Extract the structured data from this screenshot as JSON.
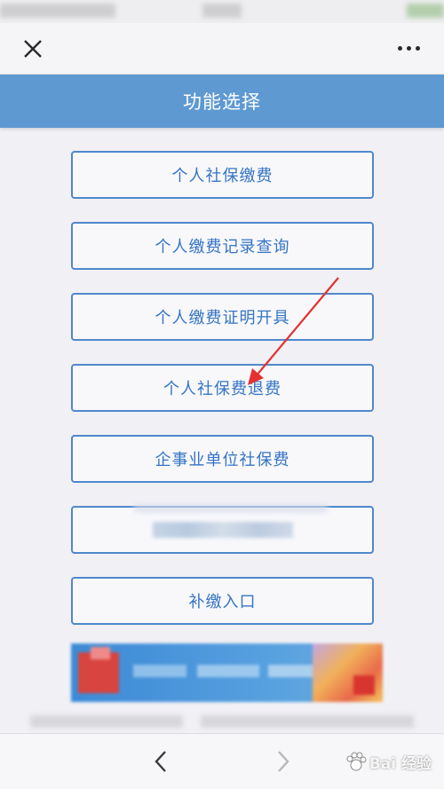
{
  "header": {
    "title": "功能选择"
  },
  "menu": {
    "items": [
      {
        "label": "个人社保缴费",
        "name": "menu-button-personal-payment"
      },
      {
        "label": "个人缴费记录查询",
        "name": "menu-button-payment-record-query"
      },
      {
        "label": "个人缴费证明开具",
        "name": "menu-button-payment-certificate"
      },
      {
        "label": "个人社保费退费",
        "name": "menu-button-personal-refund"
      },
      {
        "label": "企事业单位社保费",
        "name": "menu-button-enterprise-fee"
      },
      {
        "label": "",
        "name": "menu-button-blurred"
      },
      {
        "label": "补缴入口",
        "name": "menu-button-back-payment"
      }
    ]
  },
  "watermark": {
    "text": "Bai 经验"
  },
  "colors": {
    "title_bar": "#5e99d2",
    "button_border": "#4f88cc",
    "button_text": "#3574c4",
    "annotation_arrow": "#e53030",
    "background": "#f1f0f5"
  },
  "icons": [
    "close-icon",
    "more-icon",
    "chevron-left-icon",
    "chevron-right-icon",
    "paw-icon"
  ]
}
